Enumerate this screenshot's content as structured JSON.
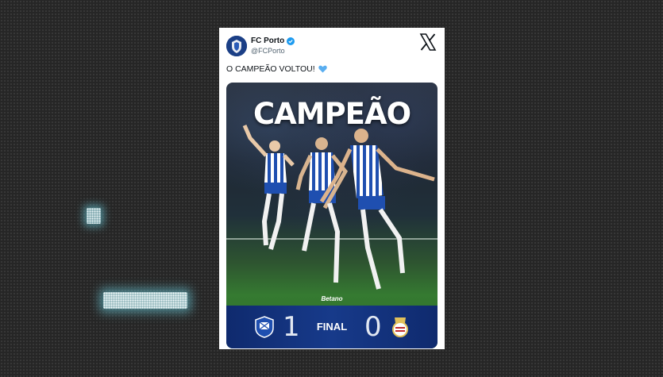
{
  "tweet": {
    "author_name": "FC Porto",
    "author_handle": "@FCPorto",
    "text": "O CAMPEÃO VOLTOU!",
    "emoji_icon": "blue-heart-icon"
  },
  "media": {
    "headline": "CAMPEÃO",
    "sponsor": "Betano",
    "scoreboard": {
      "home_score": "1",
      "status": "FINAL",
      "away_score": "0"
    }
  },
  "colors": {
    "brand_blue": "#1b3f86",
    "verified_blue": "#1d9bf0",
    "heart_blue": "#5aaef0"
  }
}
